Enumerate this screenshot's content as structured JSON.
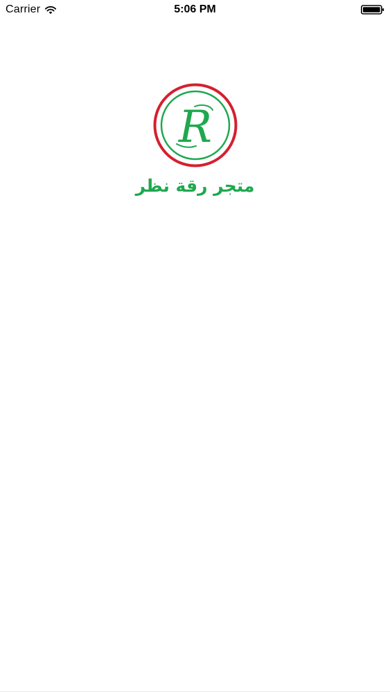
{
  "status_bar": {
    "carrier": "Carrier",
    "time": "5:06 PM",
    "wifi_icon": "wifi-icon",
    "battery_icon": "battery-icon"
  },
  "splash": {
    "logo_icon": "store-logo-icon",
    "logo_letter": "R",
    "brand_name": "متجر رقة نظر",
    "colors": {
      "ring_red": "#d4202f",
      "ring_green": "#1fa84e",
      "brand_green": "#1fa84e",
      "background": "#ffffff"
    }
  }
}
